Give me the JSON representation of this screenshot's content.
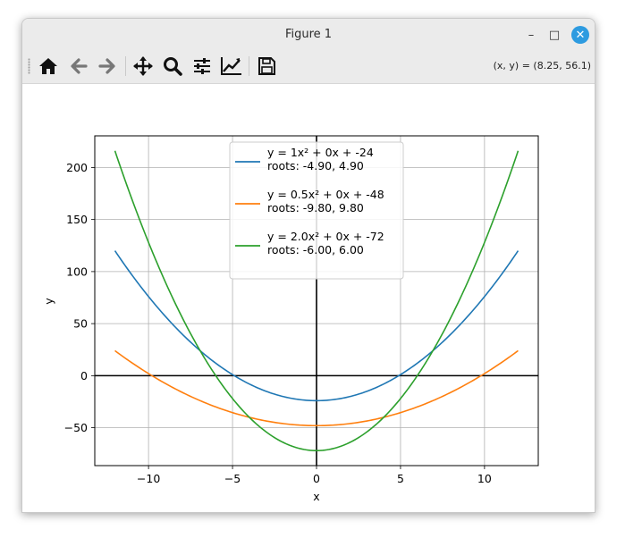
{
  "window": {
    "title": "Figure 1",
    "minimize_glyph": "–",
    "maximize_glyph": "□",
    "close_glyph": "✕"
  },
  "toolbar": {
    "buttons": [
      {
        "name": "home-button",
        "icon": "home-icon"
      },
      {
        "name": "back-button",
        "icon": "arrow-left-icon"
      },
      {
        "name": "forward-button",
        "icon": "arrow-right-icon"
      },
      {
        "name": "pan-button",
        "icon": "move-arrows-icon"
      },
      {
        "name": "zoom-button",
        "icon": "magnifier-icon"
      },
      {
        "name": "configure-subplots-button",
        "icon": "sliders-icon"
      },
      {
        "name": "edit-axis-button",
        "icon": "line-chart-icon"
      },
      {
        "name": "save-button",
        "icon": "floppy-disk-icon"
      }
    ],
    "coords_text": "(x, y) = (8.25, 56.1)"
  },
  "colors": {
    "series1": "#1f77b4",
    "series2": "#ff7f0e",
    "series3": "#2ca02c",
    "grid": "#b0b0b0",
    "axis_lines": "#000000"
  },
  "chart_data": {
    "type": "line",
    "title": "",
    "xlabel": "x",
    "ylabel": "y",
    "xlim": [
      -13.2,
      13.2
    ],
    "ylim": [
      -86.4,
      230.4
    ],
    "xticks": [
      -10,
      -5,
      0,
      5,
      10
    ],
    "xtick_labels": [
      "−10",
      "−5",
      "0",
      "5",
      "10"
    ],
    "yticks": [
      -50,
      0,
      50,
      100,
      150,
      200
    ],
    "ytick_labels": [
      "−50",
      "0",
      "50",
      "100",
      "150",
      "200"
    ],
    "grid": true,
    "zero_axes": true,
    "legend_position": "upper center",
    "x_domain": [
      -12,
      12
    ],
    "series": [
      {
        "name": "y = 1x² + 0x + -24",
        "roots_label": "roots: -4.90, 4.90",
        "a": 1,
        "b": 0,
        "c": -24
      },
      {
        "name": "y = 0.5x² + 0x + -48",
        "roots_label": "roots: -9.80, 9.80",
        "a": 0.5,
        "b": 0,
        "c": -48
      },
      {
        "name": "y = 2.0x² + 0x + -72",
        "roots_label": "roots: -6.00, 6.00",
        "a": 2,
        "b": 0,
        "c": -72
      }
    ]
  }
}
